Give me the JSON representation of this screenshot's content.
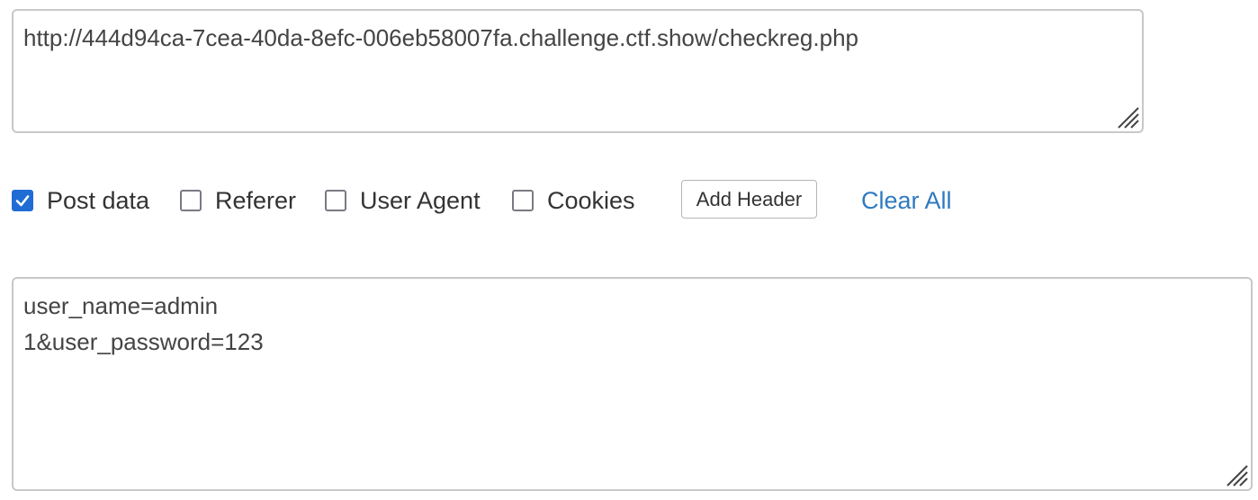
{
  "url_field": {
    "value": "http://444d94ca-7cea-40da-8efc-006eb58007fa.challenge.ctf.show/checkreg.php"
  },
  "options": [
    {
      "label": "Post data",
      "checked": true
    },
    {
      "label": "Referer",
      "checked": false
    },
    {
      "label": "User Agent",
      "checked": false
    },
    {
      "label": "Cookies",
      "checked": false
    }
  ],
  "add_header_label": "Add Header",
  "clear_all_label": "Clear All",
  "post_field": {
    "lines": [
      "user_name=admin",
      "1&user_password=123"
    ]
  },
  "colors": {
    "checkbox_checked": "#1f6dd4",
    "link": "#2f7ac0"
  }
}
